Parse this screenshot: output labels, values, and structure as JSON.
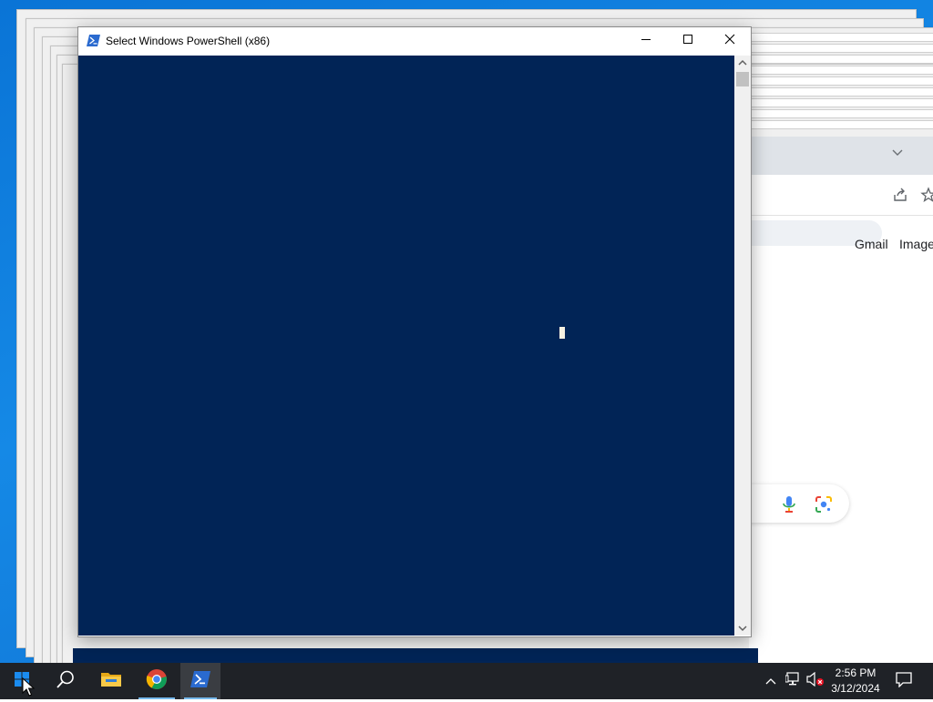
{
  "powershell_window": {
    "title": "Select Windows PowerShell (x86)",
    "console_bg": "#012456",
    "cursor_color": "#f5f0e1"
  },
  "browser_background": {
    "links": {
      "gmail": "Gmail",
      "images": "Images"
    },
    "icons": [
      "tab-dropdown-icon",
      "share-icon",
      "bookmark-star-icon",
      "voice-search-icon",
      "lens-search-icon"
    ]
  },
  "taskbar": {
    "pinned": [
      "start-button",
      "search-button",
      "file-explorer",
      "chrome",
      "powershell"
    ],
    "tray_icons": [
      "show-hidden-icons",
      "network-icon",
      "volume-muted-icon",
      "notifications-icon"
    ],
    "clock": {
      "time": "2:56 PM",
      "date": "3/12/2024"
    }
  },
  "colors": {
    "desktop": "#0f7ddb",
    "taskbar": "#1f2227",
    "active_indicator": "#76b9ed"
  }
}
